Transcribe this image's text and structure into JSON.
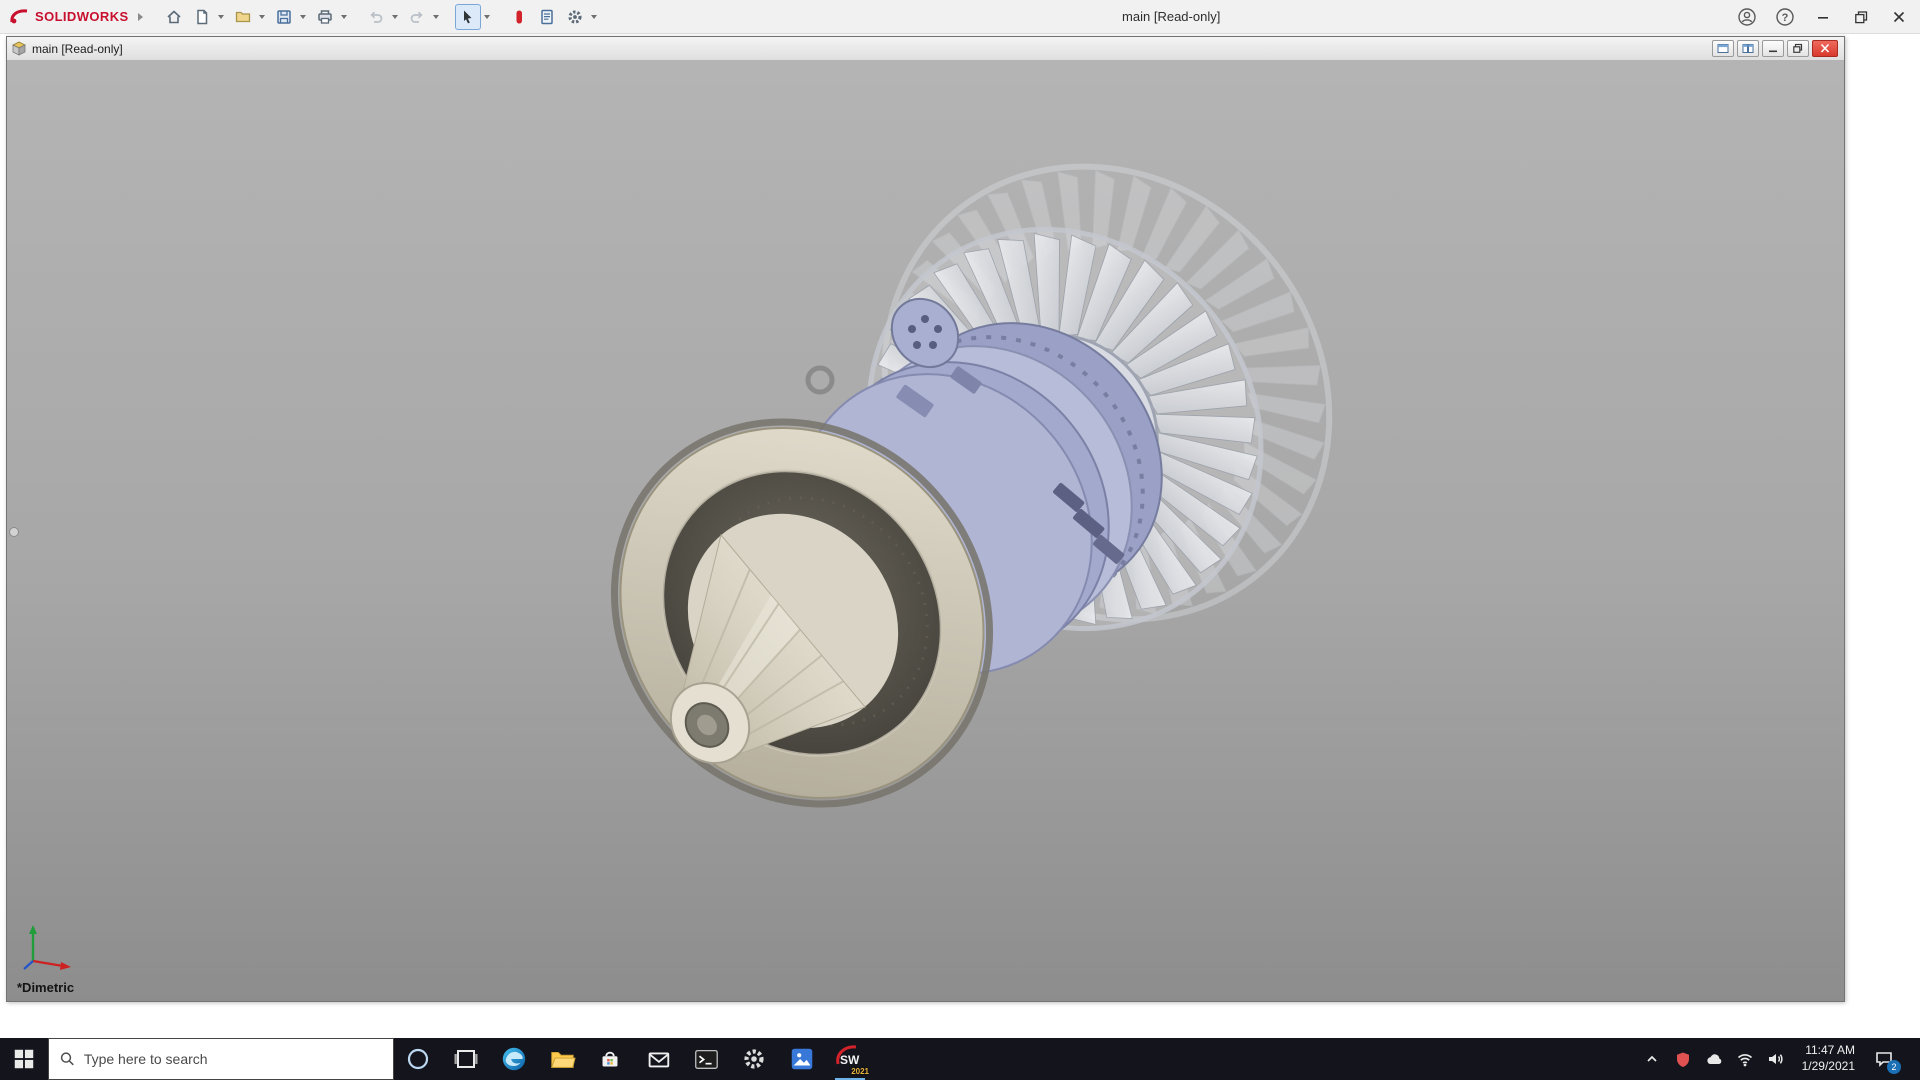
{
  "app": {
    "brand": "SOLIDWORKS",
    "brand_color": "#c8102e",
    "title": "main [Read-only]",
    "toolbar_icons": [
      "home",
      "new-document",
      "open",
      "save",
      "print",
      "undo",
      "redo",
      "select",
      "rebuild",
      "file-properties",
      "options-gear"
    ],
    "titlebar_icons": [
      "account",
      "help",
      "minimize",
      "restore",
      "close"
    ]
  },
  "document_window": {
    "title": "main [Read-only]",
    "controls": [
      "tile-horizontal",
      "tile-vertical",
      "minimize",
      "restore",
      "close"
    ]
  },
  "viewport": {
    "view_label": "*Dimetric",
    "background_top": "#b4b4b4",
    "background_bottom": "#8d8d8d",
    "triad_axis_colors": {
      "x": "#cc2222",
      "y": "#1f9d3a",
      "z": "#2255cc"
    }
  },
  "taskbar": {
    "background": "#14141d",
    "search_placeholder": "Type here to search",
    "pinned_apps": [
      "start",
      "cortana",
      "task-view",
      "edge",
      "file-explorer",
      "store",
      "mail",
      "terminal",
      "settings",
      "photos",
      "solidworks"
    ],
    "solidworks_year_badge": "2021",
    "tray": {
      "icons": [
        "hidden-icons-chevron",
        "security-shield",
        "onedrive-cloud",
        "network-wifi",
        "volume"
      ],
      "time": "11:47 AM",
      "date": "1/29/2021",
      "action_center_badge": "2"
    }
  }
}
